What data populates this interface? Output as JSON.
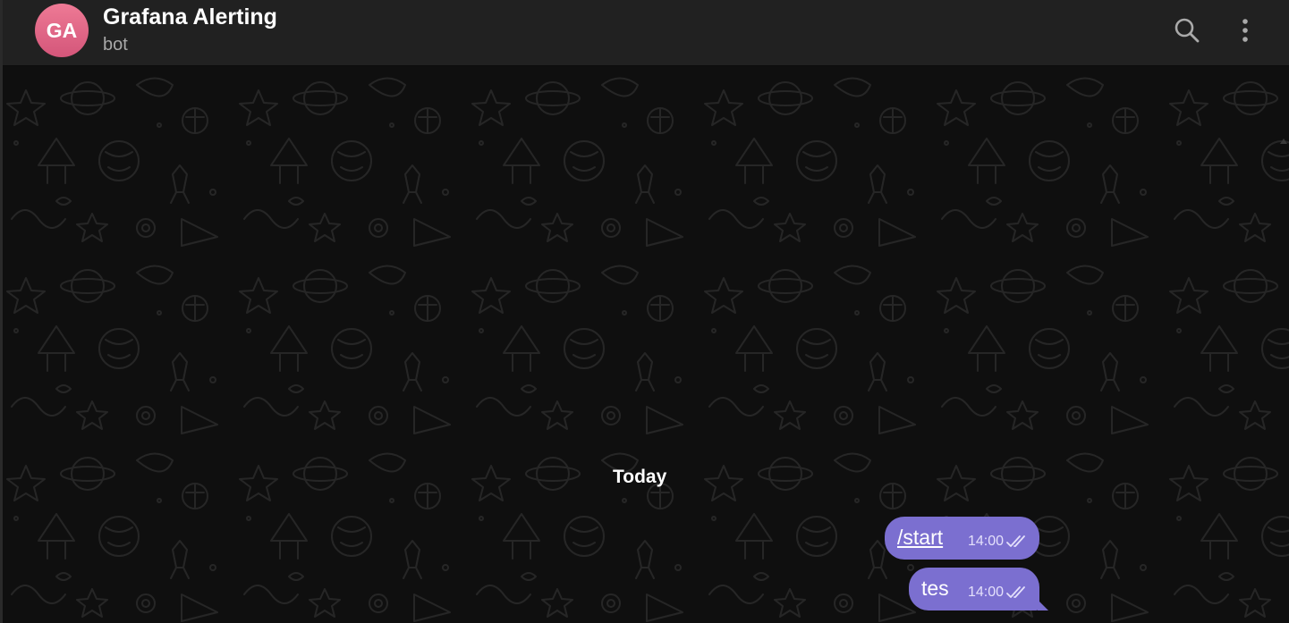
{
  "header": {
    "avatar_initials": "GA",
    "title": "Grafana Alerting",
    "subtitle": "bot",
    "search_icon": "search-icon",
    "menu_icon": "more-vertical-icon"
  },
  "chat": {
    "date_separator": "Today",
    "messages": [
      {
        "text": "/start",
        "is_link": true,
        "time": "14:00",
        "status": "read",
        "status_icon": "double-check-icon"
      },
      {
        "text": "tes",
        "is_link": false,
        "time": "14:00",
        "status": "read",
        "status_icon": "double-check-icon"
      }
    ]
  },
  "colors": {
    "header_bg": "#212121",
    "chat_bg": "#0f0f0f",
    "bubble_bg": "#7b6fd0",
    "avatar_gradient_top": "#ee7a95",
    "avatar_gradient_bottom": "#d4567a"
  }
}
